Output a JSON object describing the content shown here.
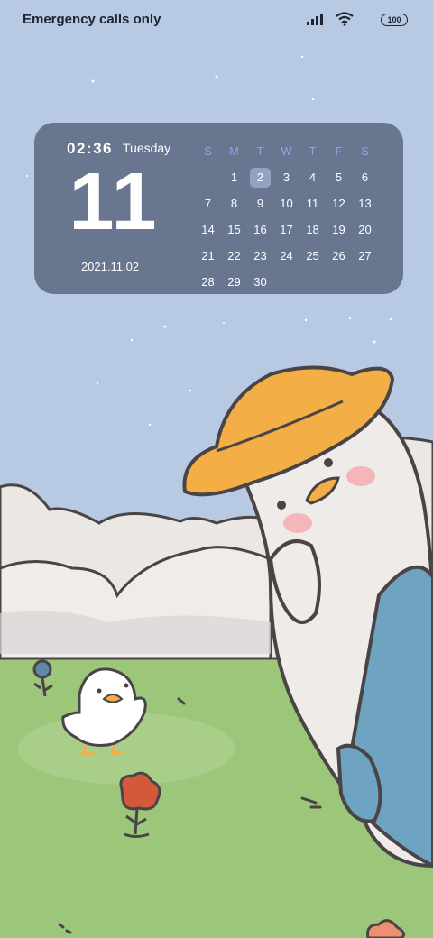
{
  "status_bar": {
    "carrier_text": "Emergency calls only",
    "battery_level": "100",
    "signal_icon": "signal-bars-icon",
    "wifi_icon": "wifi-icon"
  },
  "widget": {
    "time": "02:36",
    "weekday": "Tuesday",
    "day_number": "11",
    "date": "2021.11.02",
    "calendar": {
      "headers": [
        "S",
        "M",
        "T",
        "W",
        "T",
        "F",
        "S"
      ],
      "weeks": [
        [
          "",
          "1",
          "2",
          "3",
          "4",
          "5",
          "6"
        ],
        [
          "7",
          "8",
          "9",
          "10",
          "11",
          "12",
          "13"
        ],
        [
          "14",
          "15",
          "16",
          "17",
          "18",
          "19",
          "20"
        ],
        [
          "21",
          "22",
          "23",
          "24",
          "25",
          "26",
          "27"
        ],
        [
          "28",
          "29",
          "30",
          "",
          "",
          "",
          ""
        ]
      ],
      "today": "2"
    }
  },
  "colors": {
    "sky": "#b7c9e3",
    "widget": "#68768f",
    "calendar_header": "#8aa6e2",
    "grass": "#9cc679",
    "hat": "#f3ae45",
    "bag": "#6ea4c2"
  }
}
